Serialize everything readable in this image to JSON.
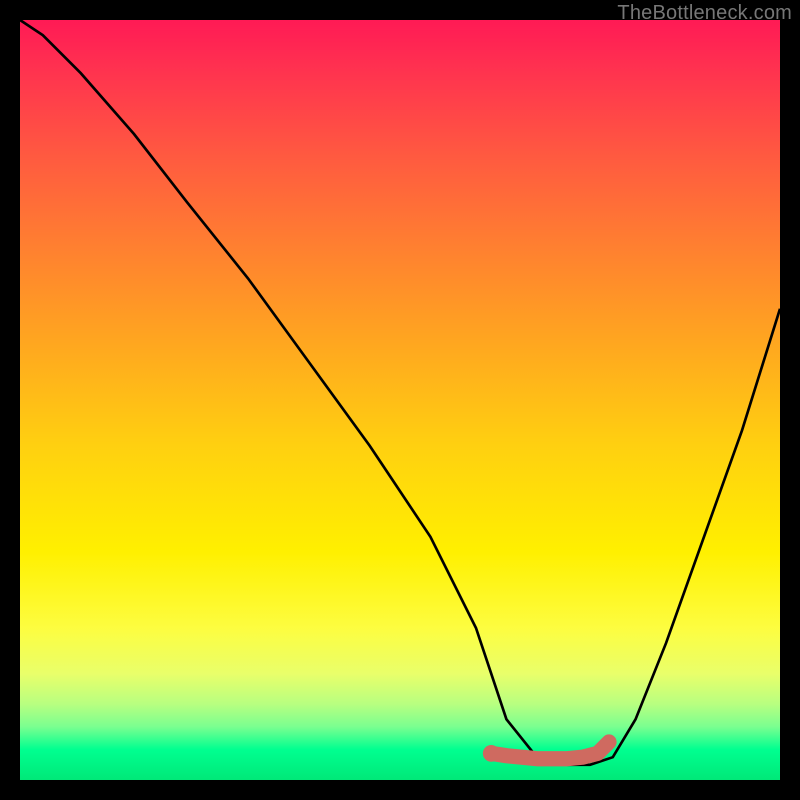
{
  "watermark": "TheBottleneck.com",
  "colors": {
    "curve_stroke": "#000000",
    "marker_stroke": "#cf6a60",
    "marker_fill": "#cf6a60"
  },
  "chart_data": {
    "type": "line",
    "title": "",
    "xlabel": "",
    "ylabel": "",
    "xlim": [
      0,
      100
    ],
    "ylim": [
      0,
      100
    ],
    "series": [
      {
        "name": "bottleneck-curve",
        "x": [
          0,
          3,
          8,
          15,
          22,
          30,
          38,
          46,
          54,
          60,
          62,
          64,
          68,
          72,
          75,
          78,
          81,
          85,
          90,
          95,
          100
        ],
        "values": [
          100,
          98,
          93,
          85,
          76,
          66,
          55,
          44,
          32,
          20,
          14,
          8,
          3,
          2,
          2,
          3,
          8,
          18,
          32,
          46,
          62
        ]
      }
    ],
    "annotations": [
      {
        "name": "optimal-range-marker",
        "x": [
          62,
          64,
          66,
          68,
          70,
          72,
          74,
          76,
          77.5
        ],
        "values": [
          3.5,
          3.2,
          3.0,
          2.8,
          2.8,
          2.8,
          3.0,
          3.5,
          5.0
        ]
      },
      {
        "name": "optimal-start-dot",
        "x": 62,
        "value": 3.5
      }
    ]
  }
}
